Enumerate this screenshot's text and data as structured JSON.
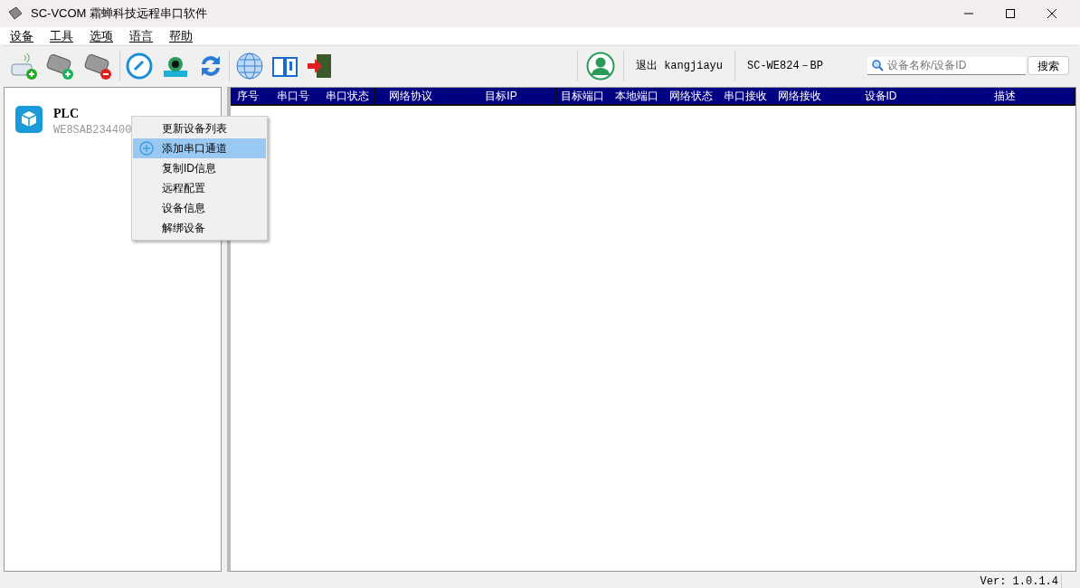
{
  "window": {
    "title": "SC-VCOM 霜蝉科技远程串口软件"
  },
  "menu": [
    "设备",
    "工具",
    "选项",
    "语言",
    "帮助"
  ],
  "toolbar": {
    "user": "退出 kangjiayu",
    "model": "SC-WE824－BP",
    "search": {
      "placeholder": "设备名称/设备ID"
    },
    "search_button": "搜索"
  },
  "devices": [
    {
      "name": "PLC",
      "id": "WE8SAB234400"
    }
  ],
  "context_menu": [
    {
      "label": "更新设备列表",
      "selected": false
    },
    {
      "label": "添加串口通道",
      "selected": true
    },
    {
      "label": "复制ID信息",
      "selected": false
    },
    {
      "label": "远程配置",
      "selected": false
    },
    {
      "label": "设备信息",
      "selected": false
    },
    {
      "label": "解绑设备",
      "selected": false
    }
  ],
  "table": {
    "columns": [
      "序号",
      "串口号",
      "串口状态",
      "网络协议",
      "目标IP",
      "目标端口",
      "本地端口",
      "网络状态",
      "串口接收",
      "网络接收",
      "设备ID",
      "描述"
    ]
  },
  "status_bar": "Ver: 1.0.1.4"
}
